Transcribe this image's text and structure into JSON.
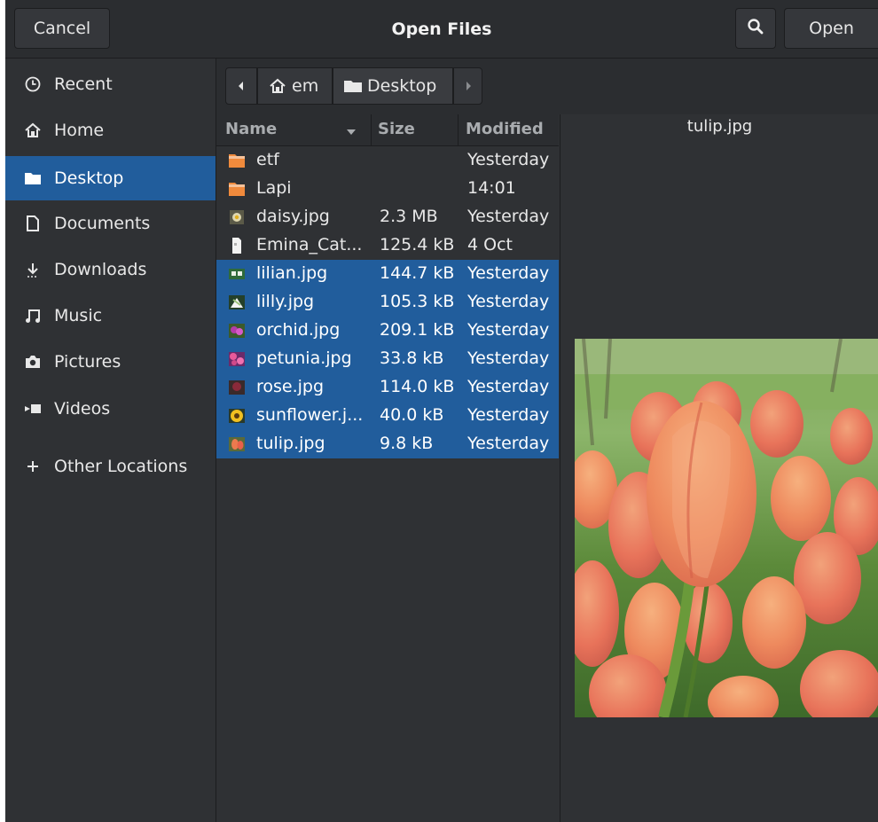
{
  "header": {
    "title": "Open Files",
    "cancel_label": "Cancel",
    "open_label": "Open",
    "search_icon": "search-icon"
  },
  "sidebar": {
    "items": [
      {
        "label": "Recent",
        "icon": "clock-icon"
      },
      {
        "label": "Home",
        "icon": "home-icon"
      },
      {
        "label": "Desktop",
        "icon": "folder-icon",
        "active": true
      },
      {
        "label": "Documents",
        "icon": "document-icon"
      },
      {
        "label": "Downloads",
        "icon": "download-icon"
      },
      {
        "label": "Music",
        "icon": "music-icon"
      },
      {
        "label": "Pictures",
        "icon": "camera-icon"
      },
      {
        "label": "Videos",
        "icon": "video-icon"
      },
      {
        "label": "Other Locations",
        "icon": "plus-icon"
      }
    ]
  },
  "pathbar": {
    "home_label": "em",
    "current_label": "Desktop"
  },
  "columns": {
    "name": "Name",
    "size": "Size",
    "modified": "Modified"
  },
  "files": [
    {
      "name": "etf",
      "size": "",
      "modified": "Yesterday",
      "kind": "folder",
      "selected": false
    },
    {
      "name": "Lapi",
      "size": "",
      "modified": "14:01",
      "kind": "folder",
      "selected": false
    },
    {
      "name": "daisy.jpg",
      "size": "2.3 MB",
      "modified": "Yesterday",
      "kind": "image",
      "selected": false
    },
    {
      "name": "Emina_Cat...",
      "size": "125.4 kB",
      "modified": "4 Oct",
      "kind": "file",
      "selected": false
    },
    {
      "name": "lilian.jpg",
      "size": "144.7 kB",
      "modified": "Yesterday",
      "kind": "image",
      "selected": true
    },
    {
      "name": "lilly.jpg",
      "size": "105.3 kB",
      "modified": "Yesterday",
      "kind": "image",
      "selected": true
    },
    {
      "name": "orchid.jpg",
      "size": "209.1 kB",
      "modified": "Yesterday",
      "kind": "image",
      "selected": true
    },
    {
      "name": "petunia.jpg",
      "size": "33.8 kB",
      "modified": "Yesterday",
      "kind": "image",
      "selected": true
    },
    {
      "name": "rose.jpg",
      "size": "114.0 kB",
      "modified": "Yesterday",
      "kind": "image",
      "selected": true
    },
    {
      "name": "sunflower.j...",
      "size": "40.0 kB",
      "modified": "Yesterday",
      "kind": "image",
      "selected": true
    },
    {
      "name": "tulip.jpg",
      "size": "9.8 kB",
      "modified": "Yesterday",
      "kind": "image",
      "selected": true
    }
  ],
  "preview": {
    "filename": "tulip.jpg"
  },
  "colors": {
    "selection": "#215d9c",
    "folder": "#f08a3c",
    "window_bg": "#2f3134"
  }
}
